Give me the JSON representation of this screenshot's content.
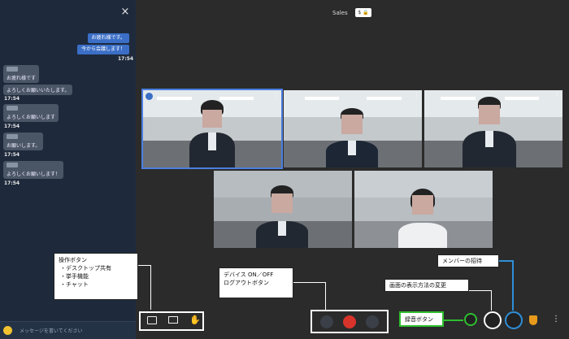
{
  "chat": {
    "close": "×",
    "outgoing": [
      "お疲れ様です。",
      "今から会議します！"
    ],
    "outgoing_time": "17:54",
    "incoming": [
      {
        "lines": [
          "お疲れ様です",
          "よろしくお願いいたします。"
        ],
        "time": "17:54"
      },
      {
        "lines": [
          "よろしくお願いします"
        ],
        "time": "17:54"
      },
      {
        "lines": [
          "お願いします。"
        ],
        "time": "17:54"
      },
      {
        "lines": [
          "よろしくお願いします！"
        ],
        "time": "17:54"
      }
    ],
    "input_placeholder": "メッセージを書いてください"
  },
  "meeting": {
    "title": "Sales",
    "security_badge": "$ 🔒"
  },
  "annotations": {
    "ops": {
      "title": "操作ボタン",
      "items": [
        "・デスクトップ共有",
        "・挙手機能",
        "・チャット"
      ]
    },
    "device": {
      "lines": [
        "デバイス ON／OFF",
        "ログアウトボタン"
      ]
    },
    "invite": "メンバーの招待",
    "layout": "画面の表示方法の変更",
    "record": "録音ボタン"
  },
  "colors": {
    "accent": "#3b6fc7",
    "hangup": "#d9342b",
    "record_border": "#2fbf2f",
    "invite_border": "#2f8fd8"
  },
  "icons": {
    "chat": "chat-icon",
    "desktop": "desktop-share-icon",
    "hand": "raise-hand-icon",
    "mic": "mic-off-icon",
    "hangup": "hangup-icon",
    "camera": "camera-icon",
    "record": "record-icon",
    "grid": "grid-icon",
    "invite": "invite-icon",
    "shield": "shield-icon",
    "more": "more-icon"
  }
}
